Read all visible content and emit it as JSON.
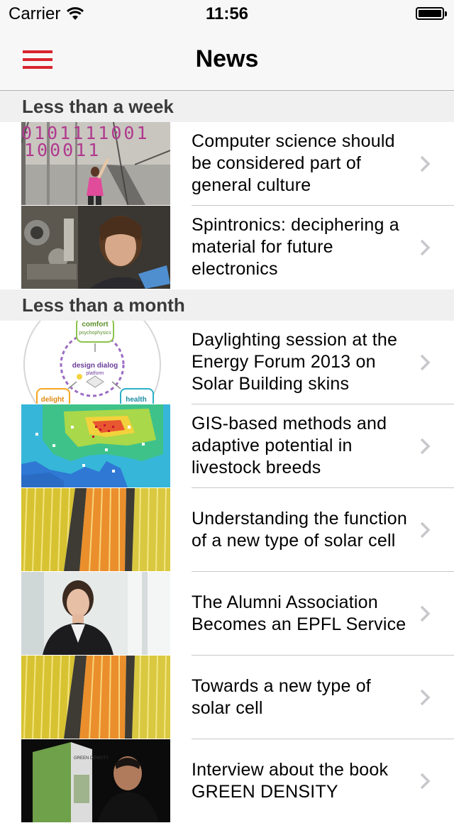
{
  "status_bar": {
    "carrier": "Carrier",
    "time": "11:56"
  },
  "nav": {
    "title": "News",
    "menu_icon": "hamburger-menu-icon",
    "accent_color": "#d9232d"
  },
  "sections": [
    {
      "header": "Less than a week",
      "items": [
        {
          "title": "Computer science should be considered part of general culture",
          "image": "binary-wall-photo"
        },
        {
          "title": "Spintronics: deciphering a material for future electronics",
          "image": "researcher-lab-photo"
        }
      ]
    },
    {
      "header": "Less than a month",
      "items": [
        {
          "title": "Daylighting session at the Energy Forum 2013 on Solar Building skins",
          "image": "design-dialog-diagram",
          "image_text": [
            "comfort",
            "psychophysics",
            "design dialog",
            "platform",
            "delight",
            "health"
          ]
        },
        {
          "title": "GIS-based methods and adaptive potential in livestock breeds",
          "image": "europe-heatmap"
        },
        {
          "title": "Understanding the function of a new type of solar cell",
          "image": "solar-glass-panels"
        },
        {
          "title": "The Alumni Association Becomes an EPFL Service",
          "image": "woman-portrait-photo"
        },
        {
          "title": "Towards a new type of solar cell",
          "image": "solar-glass-panels"
        },
        {
          "title": "Interview about the book GREEN DENSITY",
          "image": "book-interview-photo",
          "image_text": [
            "GREEN DENSITY"
          ]
        }
      ]
    }
  ]
}
